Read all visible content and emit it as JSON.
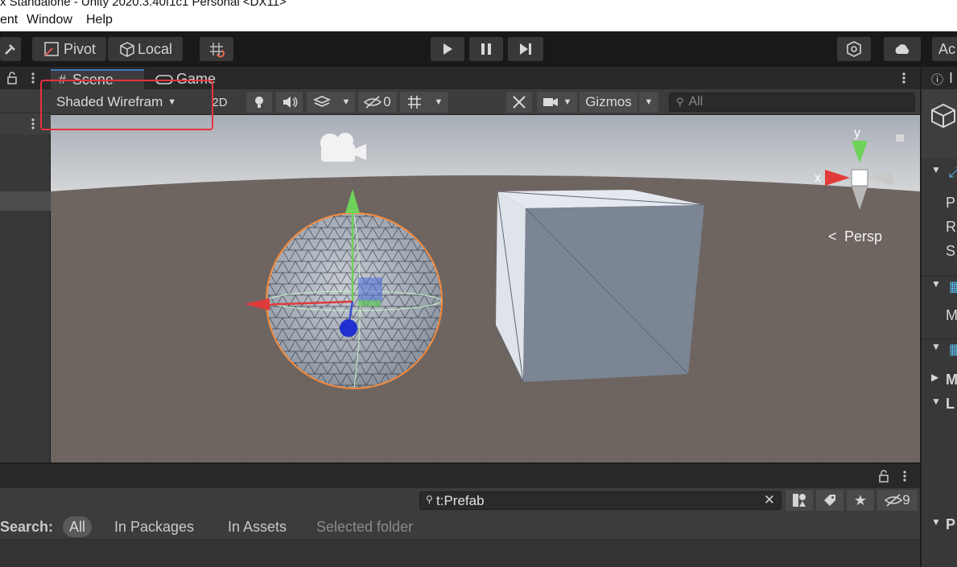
{
  "window": {
    "title": "x Standalone - Unity 2020.3.40f1c1 Personal <DX11>"
  },
  "menu": {
    "items": [
      "ent",
      "Window",
      "Help"
    ]
  },
  "toolbar": {
    "pivot_label": "Pivot",
    "local_label": "Local",
    "account_label": "Ac"
  },
  "scene": {
    "tabs": [
      "Scene",
      "Game"
    ],
    "shading_mode": "Shaded Wirefram",
    "toggle_2d": "2D",
    "hidden_count": "0",
    "gizmos_label": "Gizmos",
    "search_placeholder": "All",
    "persp_label": "Persp",
    "axis_x": "x",
    "axis_y": "y"
  },
  "inspector": {
    "tab_label": "I",
    "rows": [
      "P",
      "R",
      "S",
      "M",
      "M",
      "L",
      "P"
    ]
  },
  "project": {
    "search_value": "t:Prefab",
    "hidden_count": "9",
    "search_label": "Search:",
    "scopes": [
      "All",
      "In Packages",
      "In Assets",
      "Selected folder"
    ]
  },
  "colors": {
    "accent": "#3a79bb",
    "highlight": "#e8323f",
    "selection": "#f58a3c"
  }
}
